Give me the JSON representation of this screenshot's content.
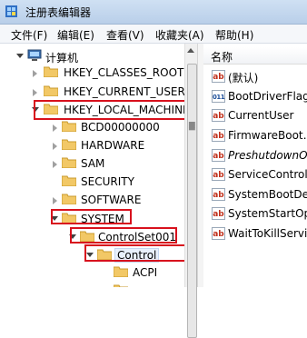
{
  "window": {
    "title": "注册表编辑器"
  },
  "menu": [
    {
      "label": "文件(F)"
    },
    {
      "label": "编辑(E)"
    },
    {
      "label": "查看(V)"
    },
    {
      "label": "收藏夹(A)"
    },
    {
      "label": "帮助(H)"
    }
  ],
  "tree": {
    "root": "计算机",
    "hives": [
      {
        "label": "HKEY_CLASSES_ROOT"
      },
      {
        "label": "HKEY_CURRENT_USER"
      },
      {
        "label": "HKEY_LOCAL_MACHINE"
      }
    ],
    "hklm_children": [
      {
        "label": "BCD00000000"
      },
      {
        "label": "HARDWARE"
      },
      {
        "label": "SAM"
      },
      {
        "label": "SECURITY"
      },
      {
        "label": "SOFTWARE"
      },
      {
        "label": "SYSTEM"
      }
    ],
    "controlset": "ControlSet001",
    "control": "Control",
    "acpi": "ACPI"
  },
  "list": {
    "column_name": "名称",
    "values": [
      {
        "label": "(默认)",
        "icon": "string-value-icon"
      },
      {
        "label": "BootDriverFlag",
        "icon": "binary-value-icon"
      },
      {
        "label": "CurrentUser",
        "icon": "string-value-icon"
      },
      {
        "label": "FirmwareBoot…",
        "icon": "string-value-icon"
      },
      {
        "label": "PreshutdownO",
        "icon": "string-value-icon"
      },
      {
        "label": "ServiceControl…",
        "icon": "string-value-icon"
      },
      {
        "label": "SystemBootDe",
        "icon": "string-value-icon"
      },
      {
        "label": "SystemStartOp",
        "icon": "string-value-icon"
      },
      {
        "label": "WaitToKillServi",
        "icon": "string-value-icon"
      }
    ]
  },
  "colors": {
    "highlight_box": "#d8111d",
    "folder": "#f2c866"
  }
}
